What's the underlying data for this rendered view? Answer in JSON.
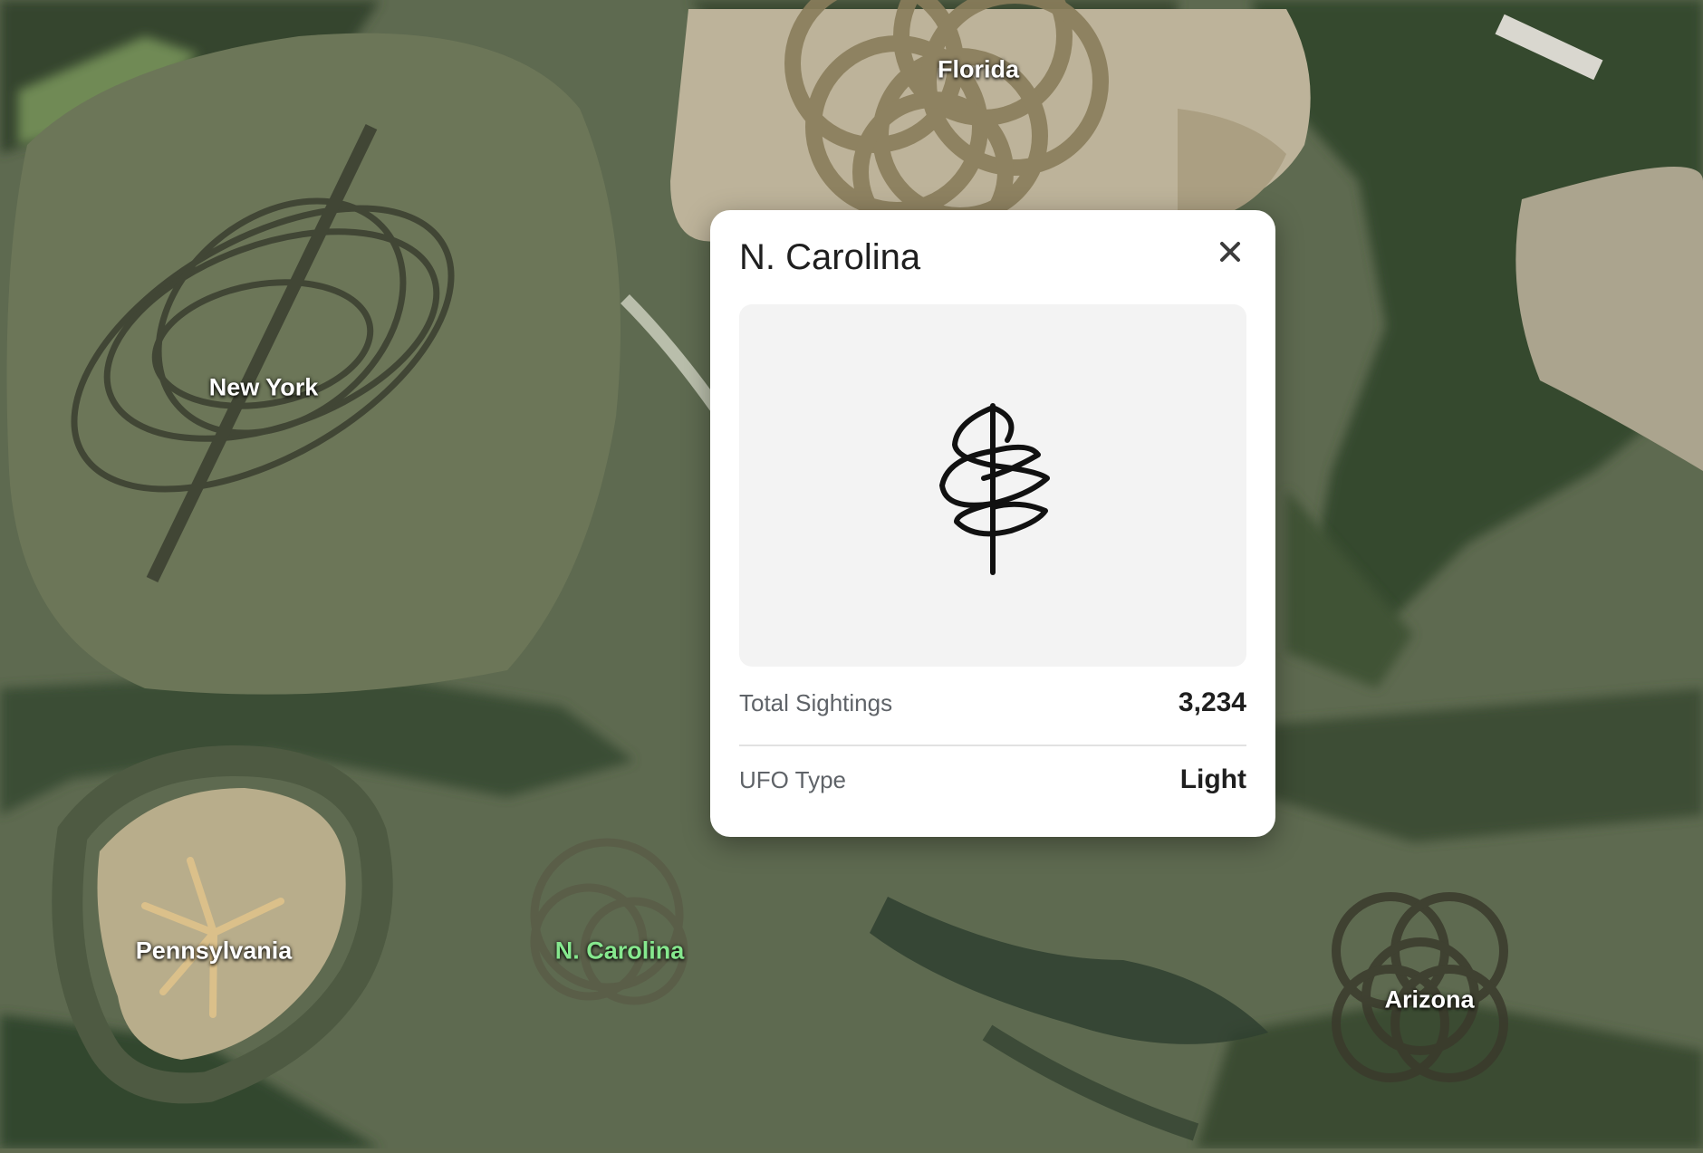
{
  "markers": [
    {
      "id": "new-york",
      "label": "New York"
    },
    {
      "id": "florida",
      "label": "Florida"
    },
    {
      "id": "pennsylvania",
      "label": "Pennsylvania"
    },
    {
      "id": "n-carolina",
      "label": "N. Carolina"
    },
    {
      "id": "arizona",
      "label": "Arizona"
    }
  ],
  "popup": {
    "title": "N. Carolina",
    "close_icon": "close-icon",
    "preview_icon": "spiral-ufo-symbol-icon",
    "rows": [
      {
        "label": "Total Sightings",
        "value": "3,234"
      },
      {
        "label": "UFO Type",
        "value": "Light"
      }
    ]
  },
  "colors": {
    "active_marker": "#86e88e",
    "marker_text": "#ffffff",
    "popup_bg": "#ffffff",
    "preview_bg": "#f3f3f3"
  }
}
